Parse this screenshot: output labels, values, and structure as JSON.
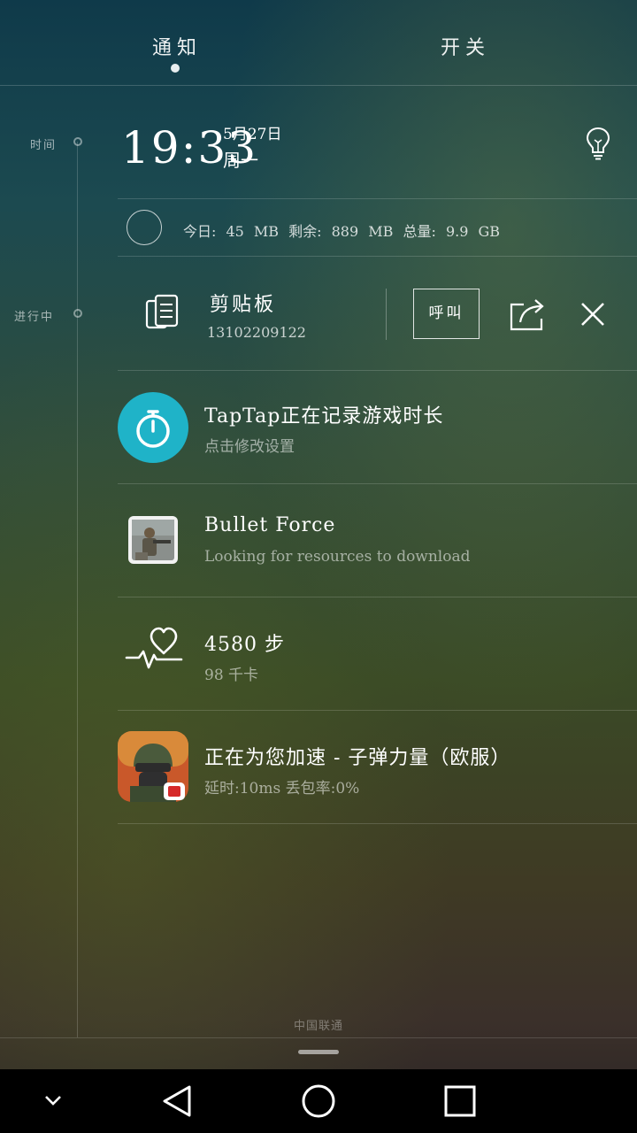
{
  "tabs": {
    "notifications": "通知",
    "switches": "开关"
  },
  "timeline": {
    "time_label": "时间",
    "ongoing_label": "进行中"
  },
  "clock": {
    "time": "19:33",
    "date": "5月27日",
    "weekday": "周一"
  },
  "data_usage": {
    "text": "今日: 45 MB  剩余: 889 MB  总量: 9.9 GB"
  },
  "clipboard": {
    "title": "剪贴板",
    "content": "13102209122",
    "call_label": "呼叫"
  },
  "notifications": [
    {
      "title": "TapTap正在记录游戏时长",
      "subtitle": "点击修改设置",
      "icon": "stopwatch-icon"
    },
    {
      "title": "Bullet Force",
      "subtitle": "Looking for resources to download",
      "icon": "bullet-force-app-icon"
    },
    {
      "title": "4580 步",
      "subtitle": "98 千卡",
      "icon": "heart-rate-icon"
    },
    {
      "title": "正在为您加速 - 子弹力量（欧服）",
      "subtitle": "延时:10ms   丢包率:0%",
      "icon": "game-accelerator-icon"
    }
  ],
  "footer": {
    "carrier": "中国联通"
  },
  "colors": {
    "accent_teal": "#1fb3c8",
    "nav_bar": "#000000"
  }
}
